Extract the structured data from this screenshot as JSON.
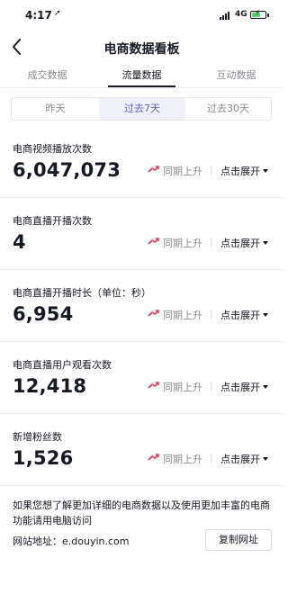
{
  "status_bar": {
    "time": "4:17",
    "location_glyph": "➚",
    "network": "4G",
    "battery_level": 0.55,
    "battery_color": "#4cd964"
  },
  "nav": {
    "title": "电商数据看板",
    "back_icon": "chevron-left-icon"
  },
  "tabs": [
    {
      "label": "成交数据",
      "active": false
    },
    {
      "label": "流量数据",
      "active": true
    },
    {
      "label": "互动数据",
      "active": false
    }
  ],
  "periods": [
    {
      "label": "昨天",
      "active": false
    },
    {
      "label": "过去7天",
      "active": true
    },
    {
      "label": "过去30天",
      "active": false
    }
  ],
  "metrics": [
    {
      "label": "电商视频播放次数",
      "value": "6,047,073",
      "trend": "同期上升",
      "expand": "点击展开"
    },
    {
      "label": "电商直播开播次数",
      "value": "4",
      "trend": "同期上升",
      "expand": "点击展开"
    },
    {
      "label": "电商直播开播时长（单位：秒）",
      "value": "6,954",
      "trend": "同期上升",
      "expand": "点击展开"
    },
    {
      "label": "电商直播用户观看次数",
      "value": "12,418",
      "trend": "同期上升",
      "expand": "点击展开"
    },
    {
      "label": "新增粉丝数",
      "value": "1,526",
      "trend": "同期上升",
      "expand": "点击展开"
    }
  ],
  "footer": {
    "note": "如果您想了解更加详细的电商数据以及使用更加丰富的电商功能请用电脑访问",
    "site": "网站地址：e.douyin.com",
    "copy_button": "复制网址"
  },
  "colors": {
    "accent": "#5b5ee8",
    "trend_up": "#fe2c55",
    "muted": "#8a8b91",
    "text": "#161823"
  }
}
